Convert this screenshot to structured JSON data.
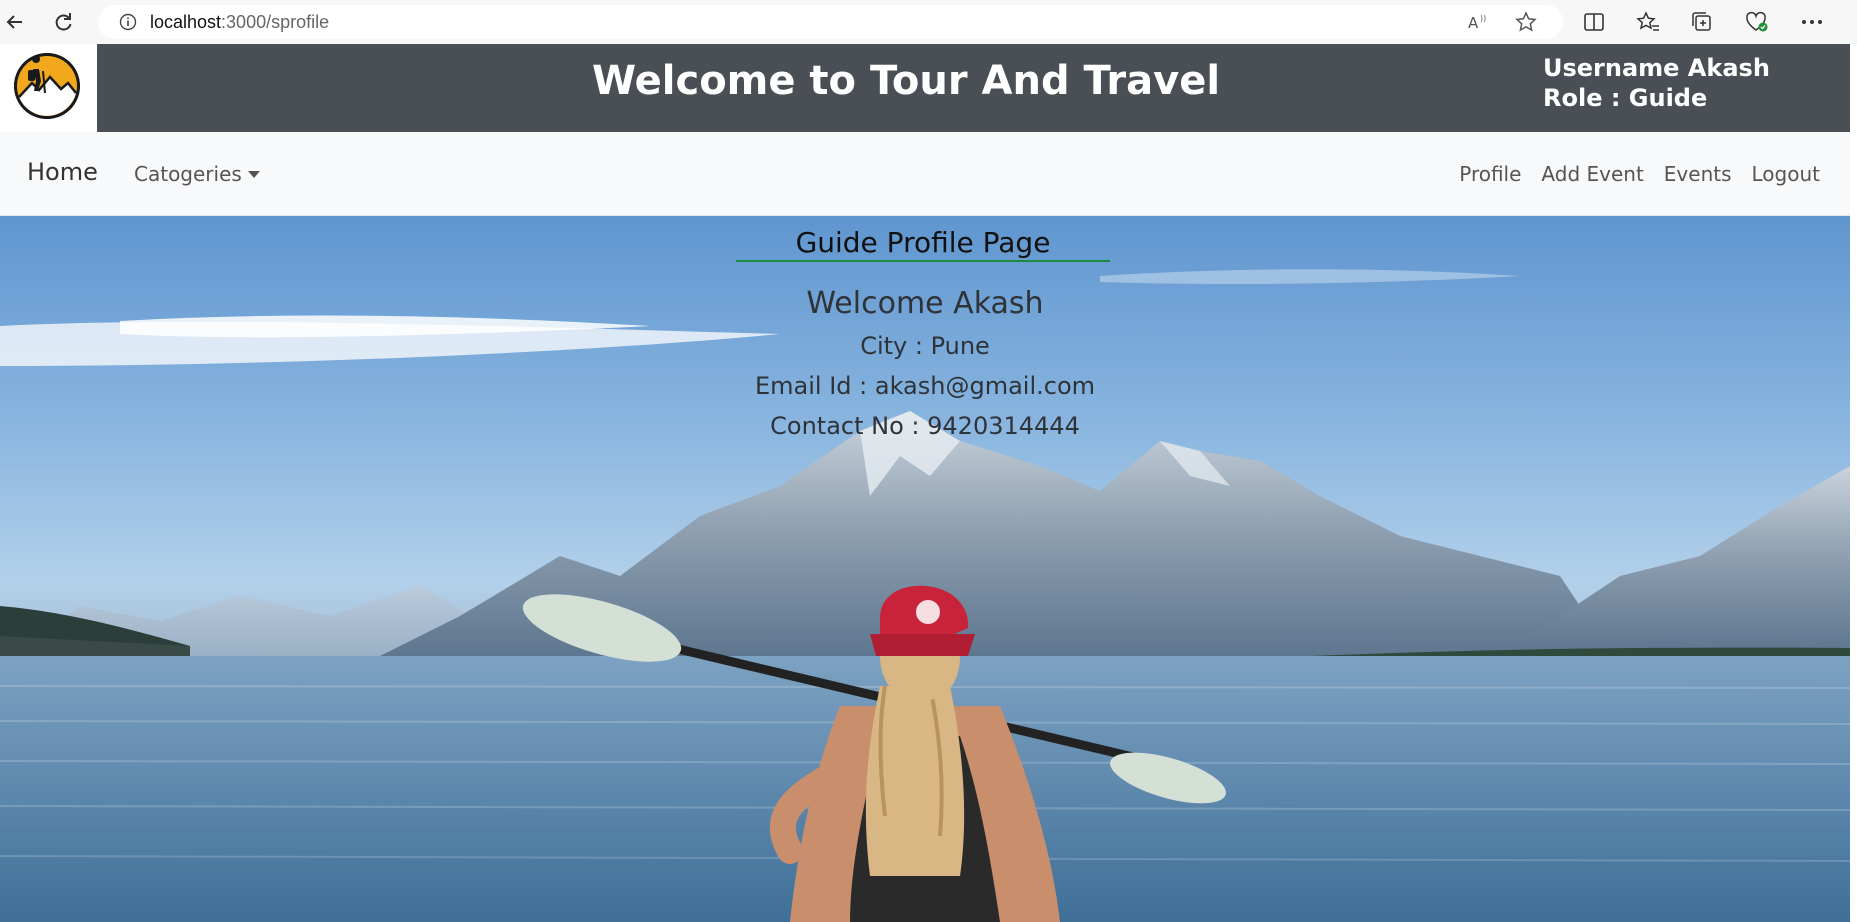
{
  "browser": {
    "url_host": "localhost",
    "url_path": ":3000/sprofile"
  },
  "header": {
    "title": "Welcome to Tour And Travel",
    "username_line": "Username Akash",
    "role_line": "Role : Guide"
  },
  "nav": {
    "home": "Home",
    "categories": "Catogeries",
    "right_items": [
      "Profile",
      "Add Event",
      "Events",
      "Logout"
    ]
  },
  "profile": {
    "heading": "Guide Profile Page",
    "welcome": "Welcome Akash",
    "city": "City : Pune",
    "email": "Email Id : akash@gmail.com",
    "contact": "Contact No : 9420314444"
  },
  "colors": {
    "header_band": "#4a4f56",
    "navbar_bg": "#f8f9fa",
    "heading_underline": "#1c8a3e"
  }
}
